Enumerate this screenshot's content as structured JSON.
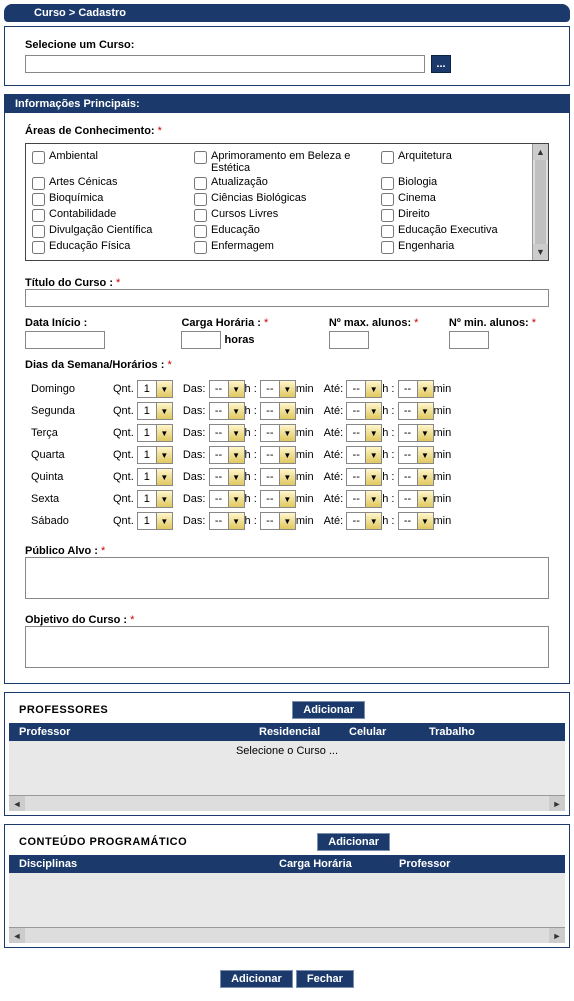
{
  "header": {
    "breadcrumb": "Curso > Cadastro"
  },
  "selectCourse": {
    "label": "Selecione um Curso:",
    "value": "",
    "browse": "..."
  },
  "main": {
    "title": "Informações Principais:",
    "areas": {
      "label": "Áreas de Conhecimento:",
      "col1": [
        "Ambiental",
        "Artes Cénicas",
        "Bioquímica",
        "Contabilidade",
        "Divulgação Científica",
        "Educação Física"
      ],
      "col2": [
        "Aprimoramento em Beleza e Estética",
        "Atualização",
        "Ciências Biológicas",
        "Cursos Livres",
        "Educação",
        "Enfermagem"
      ],
      "col3": [
        "Arquitetura",
        "Biologia",
        "Cinema",
        "Direito",
        "Educação Executiva",
        "Engenharia"
      ]
    },
    "titulo": {
      "label": "Título do Curso :",
      "value": ""
    },
    "dataInicio": {
      "label": "Data Início :",
      "value": ""
    },
    "cargaHoraria": {
      "label": "Carga Horária :",
      "value": "",
      "unit": "horas"
    },
    "maxAlunos": {
      "label": "Nº max. alunos:",
      "value": ""
    },
    "minAlunos": {
      "label": "Nº min. alunos:",
      "value": ""
    },
    "dias": {
      "label": "Dias da Semana/Horários :",
      "qntLabel": "Qnt.",
      "dasLabel": "Das:",
      "ateLabel": "Até:",
      "hLabel": "h :",
      "minLabel": "min",
      "defaultQnt": "1",
      "dash": "--",
      "names": [
        "Domingo",
        "Segunda",
        "Terça",
        "Quarta",
        "Quinta",
        "Sexta",
        "Sábado"
      ]
    },
    "publicoAlvo": {
      "label": "Público Alvo :",
      "value": ""
    },
    "objetivo": {
      "label": "Objetivo do Curso :",
      "value": ""
    }
  },
  "professores": {
    "title": "PROFESSORES",
    "addBtn": "Adicionar",
    "cols": [
      "Professor",
      "Residencial",
      "Celular",
      "Trabalho"
    ],
    "emptyMsg": "Selecione o Curso ..."
  },
  "conteudo": {
    "title": "CONTEÚDO PROGRAMÁTICO",
    "addBtn": "Adicionar",
    "cols": [
      "Disciplinas",
      "Carga Horária",
      "Professor"
    ]
  },
  "footer": {
    "add": "Adicionar",
    "close": "Fechar"
  }
}
